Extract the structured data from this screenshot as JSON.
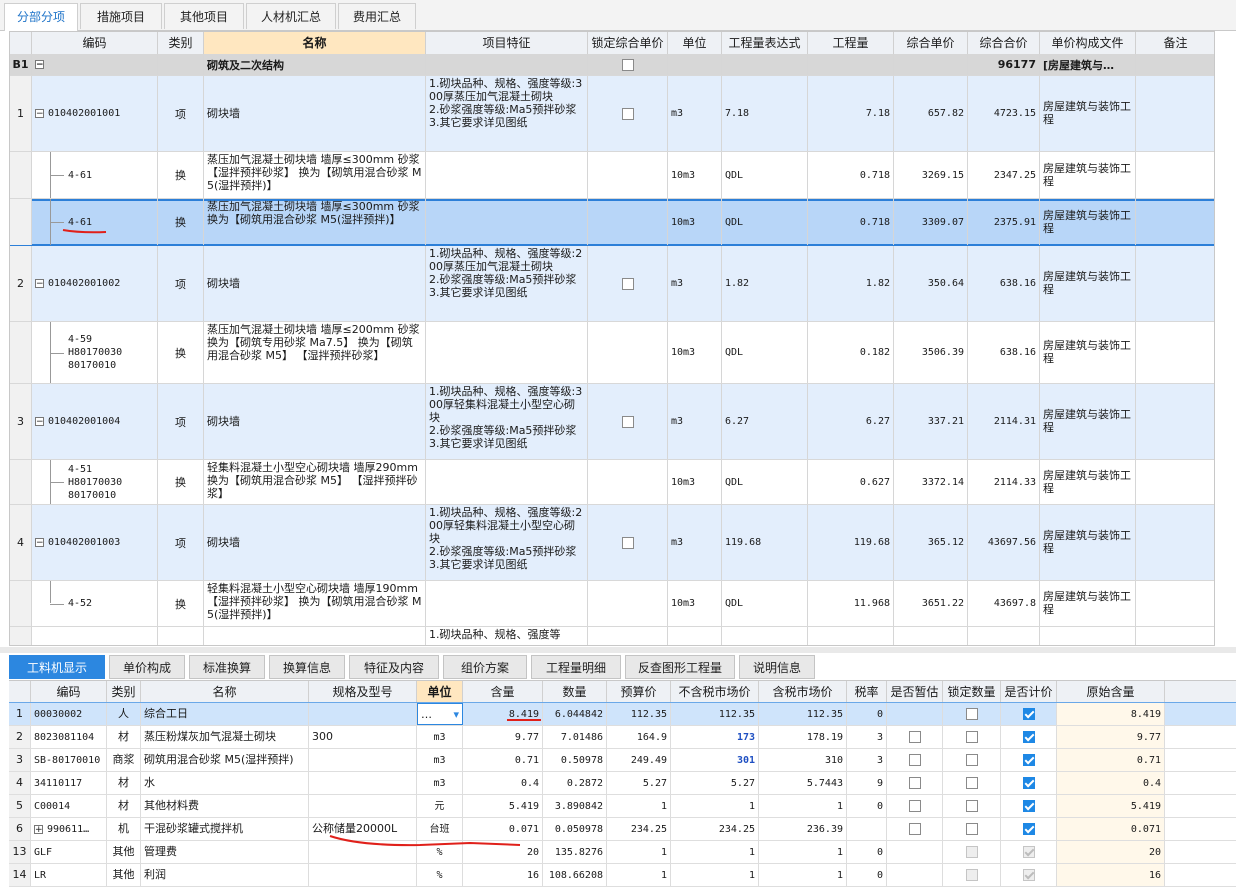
{
  "top_tabs": [
    "分部分项",
    "措施项目",
    "其他项目",
    "人材机汇总",
    "费用汇总"
  ],
  "upper": {
    "headers": [
      "编码",
      "类别",
      "名称",
      "项目特征",
      "锁定综合单价",
      "单位",
      "工程量表达式",
      "工程量",
      "综合单价",
      "综合合价",
      "单价构成文件",
      "备注"
    ],
    "b1": {
      "label": "B1",
      "name": "砌筑及二次结构",
      "total": "96177",
      "file": "[房屋建筑与…"
    },
    "rows": [
      {
        "num": "1",
        "code": "010402001001",
        "type": "项",
        "name": "砌块墙",
        "feature": "1.砌块品种、规格、强度等级:300厚蒸压加气混凝土砌块\n2.砂浆强度等级:Ma5预拌砂浆\n3.其它要求详见图纸",
        "unit": "m3",
        "expr": "7.18",
        "qty": "7.18",
        "price": "657.82",
        "total": "4723.15",
        "file": "房屋建筑与装饰工程"
      },
      {
        "num": "",
        "code": "4-61",
        "type": "换",
        "name": "蒸压加气混凝土砌块墙 墙厚≤300mm 砂浆 【湿拌预拌砂浆】 换为【砌筑用混合砂浆 M5(湿拌预拌)】",
        "feature": "",
        "unit": "10m3",
        "expr": "QDL",
        "qty": "0.718",
        "price": "3269.15",
        "total": "2347.25",
        "file": "房屋建筑与装饰工程"
      },
      {
        "num": "",
        "code": "4-61",
        "type": "换",
        "name": "蒸压加气混凝土砌块墙 墙厚≤300mm 砂浆 换为【砌筑用混合砂浆 M5(湿拌预拌)】",
        "feature": "",
        "unit": "10m3",
        "expr": "QDL",
        "qty": "0.718",
        "price": "3309.07",
        "total": "2375.91",
        "file": "房屋建筑与装饰工程"
      },
      {
        "num": "2",
        "code": "010402001002",
        "type": "项",
        "name": "砌块墙",
        "feature": "1.砌块品种、规格、强度等级:200厚蒸压加气混凝土砌块\n2.砂浆强度等级:Ma5预拌砂浆\n3.其它要求详见图纸",
        "unit": "m3",
        "expr": "1.82",
        "qty": "1.82",
        "price": "350.64",
        "total": "638.16",
        "file": "房屋建筑与装饰工程"
      },
      {
        "num": "",
        "code": "4-59\nH80170030\n80170010",
        "type": "换",
        "name": "蒸压加气混凝土砌块墙 墙厚≤200mm 砂浆 换为【砌筑专用砂浆 Ma7.5】 换为【砌筑用混合砂浆 M5】 【湿拌预拌砂浆】",
        "feature": "",
        "unit": "10m3",
        "expr": "QDL",
        "qty": "0.182",
        "price": "3506.39",
        "total": "638.16",
        "file": "房屋建筑与装饰工程"
      },
      {
        "num": "3",
        "code": "010402001004",
        "type": "项",
        "name": "砌块墙",
        "feature": "1.砌块品种、规格、强度等级:300厚轻集料混凝土小型空心砌块\n2.砂浆强度等级:Ma5预拌砂浆\n3.其它要求详见图纸",
        "unit": "m3",
        "expr": "6.27",
        "qty": "6.27",
        "price": "337.21",
        "total": "2114.31",
        "file": "房屋建筑与装饰工程"
      },
      {
        "num": "",
        "code": "4-51\nH80170030\n80170010",
        "type": "换",
        "name": "轻集料混凝土小型空心砌块墙 墙厚290mm 换为【砌筑用混合砂浆 M5】 【湿拌预拌砂浆】",
        "feature": "",
        "unit": "10m3",
        "expr": "QDL",
        "qty": "0.627",
        "price": "3372.14",
        "total": "2114.33",
        "file": "房屋建筑与装饰工程"
      },
      {
        "num": "4",
        "code": "010402001003",
        "type": "项",
        "name": "砌块墙",
        "feature": "1.砌块品种、规格、强度等级:200厚轻集料混凝土小型空心砌块\n2.砂浆强度等级:Ma5预拌砂浆\n3.其它要求详见图纸",
        "unit": "m3",
        "expr": "119.68",
        "qty": "119.68",
        "price": "365.12",
        "total": "43697.56",
        "file": "房屋建筑与装饰工程"
      },
      {
        "num": "",
        "code": "4-52",
        "type": "换",
        "name": "轻集料混凝土小型空心砌块墙 墙厚190mm 【湿拌预拌砂浆】 换为【砌筑用混合砂浆 M5(湿拌预拌)】",
        "feature": "",
        "unit": "10m3",
        "expr": "QDL",
        "qty": "11.968",
        "price": "3651.22",
        "total": "43697.8",
        "file": "房屋建筑与装饰工程"
      },
      {
        "num": "",
        "code": "",
        "type": "",
        "name": "",
        "feature": "1.砌块品种、规格、强度等",
        "unit": "",
        "expr": "",
        "qty": "",
        "price": "",
        "total": "",
        "file": ""
      }
    ]
  },
  "lower_tabs": [
    "工料机显示",
    "单价构成",
    "标准换算",
    "换算信息",
    "特征及内容",
    "组价方案",
    "工程量明细",
    "反查图形工程量",
    "说明信息"
  ],
  "lower": {
    "headers": [
      "编码",
      "类别",
      "名称",
      "规格及型号",
      "单位",
      "含量",
      "数量",
      "预算价",
      "不含税市场价",
      "含税市场价",
      "税率",
      "是否暂估",
      "锁定数量",
      "是否计价",
      "原始含量"
    ],
    "unit_dropdown_glyph": "…",
    "rows": [
      {
        "num": "1",
        "code": "00030002",
        "type": "人",
        "name": "综合工日",
        "spec": "",
        "unit": "",
        "content": "8.419",
        "amount": "6.044842",
        "budget": "112.35",
        "mkt": "112.35",
        "mkt_tax": "112.35",
        "rate": "0",
        "orig": "8.419"
      },
      {
        "num": "2",
        "code": "8023081104",
        "type": "材",
        "name": "蒸压粉煤灰加气混凝土砌块",
        "spec": "300",
        "unit": "m3",
        "content": "9.77",
        "amount": "7.01486",
        "budget": "164.9",
        "mkt": "173",
        "mkt_tax": "178.19",
        "rate": "3",
        "orig": "9.77"
      },
      {
        "num": "3",
        "code": "SB-80170010",
        "type": "商浆",
        "name": "砌筑用混合砂浆 M5(湿拌预拌)",
        "spec": "",
        "unit": "m3",
        "content": "0.71",
        "amount": "0.50978",
        "budget": "249.49",
        "mkt": "301",
        "mkt_tax": "310",
        "rate": "3",
        "orig": "0.71"
      },
      {
        "num": "4",
        "code": "34110117",
        "type": "材",
        "name": "水",
        "spec": "",
        "unit": "m3",
        "content": "0.4",
        "amount": "0.2872",
        "budget": "5.27",
        "mkt": "5.27",
        "mkt_tax": "5.7443",
        "rate": "9",
        "orig": "0.4"
      },
      {
        "num": "5",
        "code": "C00014",
        "type": "材",
        "name": "其他材料费",
        "spec": "",
        "unit": "元",
        "content": "5.419",
        "amount": "3.890842",
        "budget": "1",
        "mkt": "1",
        "mkt_tax": "1",
        "rate": "0",
        "orig": "5.419"
      },
      {
        "num": "6",
        "code": "990611…",
        "type": "机",
        "name": "干混砂浆罐式搅拌机",
        "spec": "公称储量20000L",
        "unit": "台班",
        "content": "0.071",
        "amount": "0.050978",
        "budget": "234.25",
        "mkt": "234.25",
        "mkt_tax": "236.39",
        "rate": "",
        "orig": "0.071"
      },
      {
        "num": "13",
        "code": "GLF",
        "type": "其他",
        "name": "管理费",
        "spec": "",
        "unit": "%",
        "content": "20",
        "amount": "135.8276",
        "budget": "1",
        "mkt": "1",
        "mkt_tax": "1",
        "rate": "0",
        "orig": "20"
      },
      {
        "num": "14",
        "code": "LR",
        "type": "其他",
        "name": "利润",
        "spec": "",
        "unit": "%",
        "content": "16",
        "amount": "108.66208",
        "budget": "1",
        "mkt": "1",
        "mkt_tax": "1",
        "rate": "0",
        "orig": "16"
      }
    ]
  },
  "colors": {
    "accent": "#2c87e0",
    "selected_row": "#b8d6f8",
    "item_row": "#e3eefc",
    "annotation_red": "#e0201a"
  }
}
